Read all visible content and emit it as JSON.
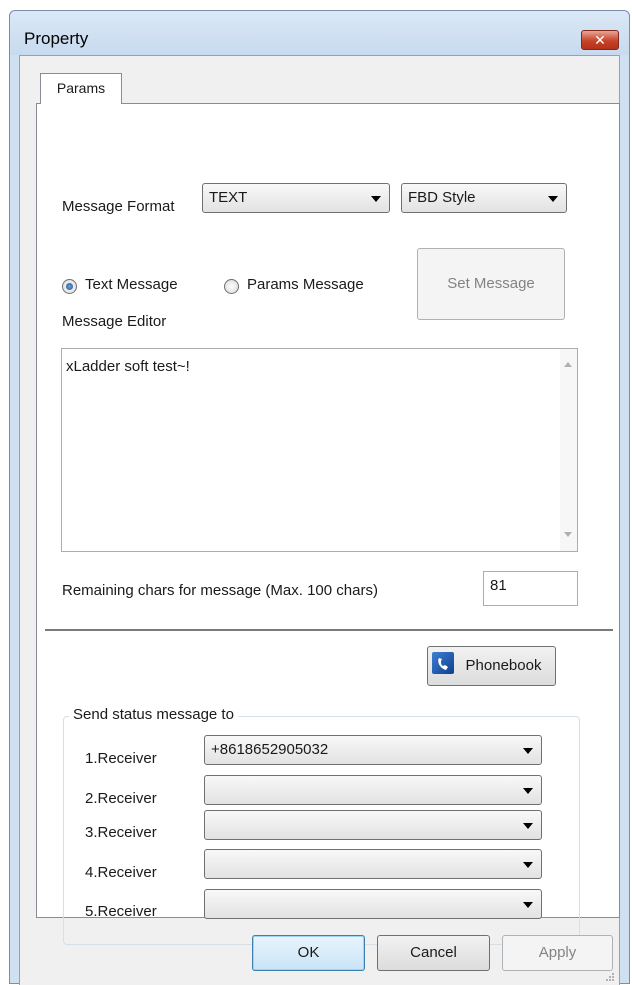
{
  "window": {
    "title": "Property",
    "close_glyph": "✕"
  },
  "tabs": [
    {
      "label": "Params"
    }
  ],
  "params": {
    "message_format_label": "Message Format",
    "format_value": "TEXT",
    "style_value": "FBD Style",
    "text_message_label": "Text Message",
    "text_message_checked": true,
    "params_message_label": "Params Message",
    "params_message_checked": false,
    "set_message_label": "Set Message",
    "message_editor_label": "Message Editor",
    "message_text": "xLadder soft test~!",
    "remaining_label": "Remaining chars for message (Max. 100 chars)",
    "remaining_value": "81",
    "phonebook_label": "Phonebook"
  },
  "receivers_group": {
    "title": "Send status message to",
    "receivers": [
      {
        "label": "1.Receiver",
        "value": "+8618652905032"
      },
      {
        "label": "2.Receiver",
        "value": ""
      },
      {
        "label": "3.Receiver",
        "value": ""
      },
      {
        "label": "4.Receiver",
        "value": ""
      },
      {
        "label": "5.Receiver",
        "value": ""
      }
    ]
  },
  "footer": {
    "ok_label": "OK",
    "cancel_label": "Cancel",
    "apply_label": "Apply"
  },
  "icons": {
    "phonebook_icon": "phone-icon",
    "close_icon": "close-icon"
  },
  "colors": {
    "title_bar": "#cfe0f1",
    "close_button": "#c6432a",
    "phone_icon": "#1b4f91"
  }
}
